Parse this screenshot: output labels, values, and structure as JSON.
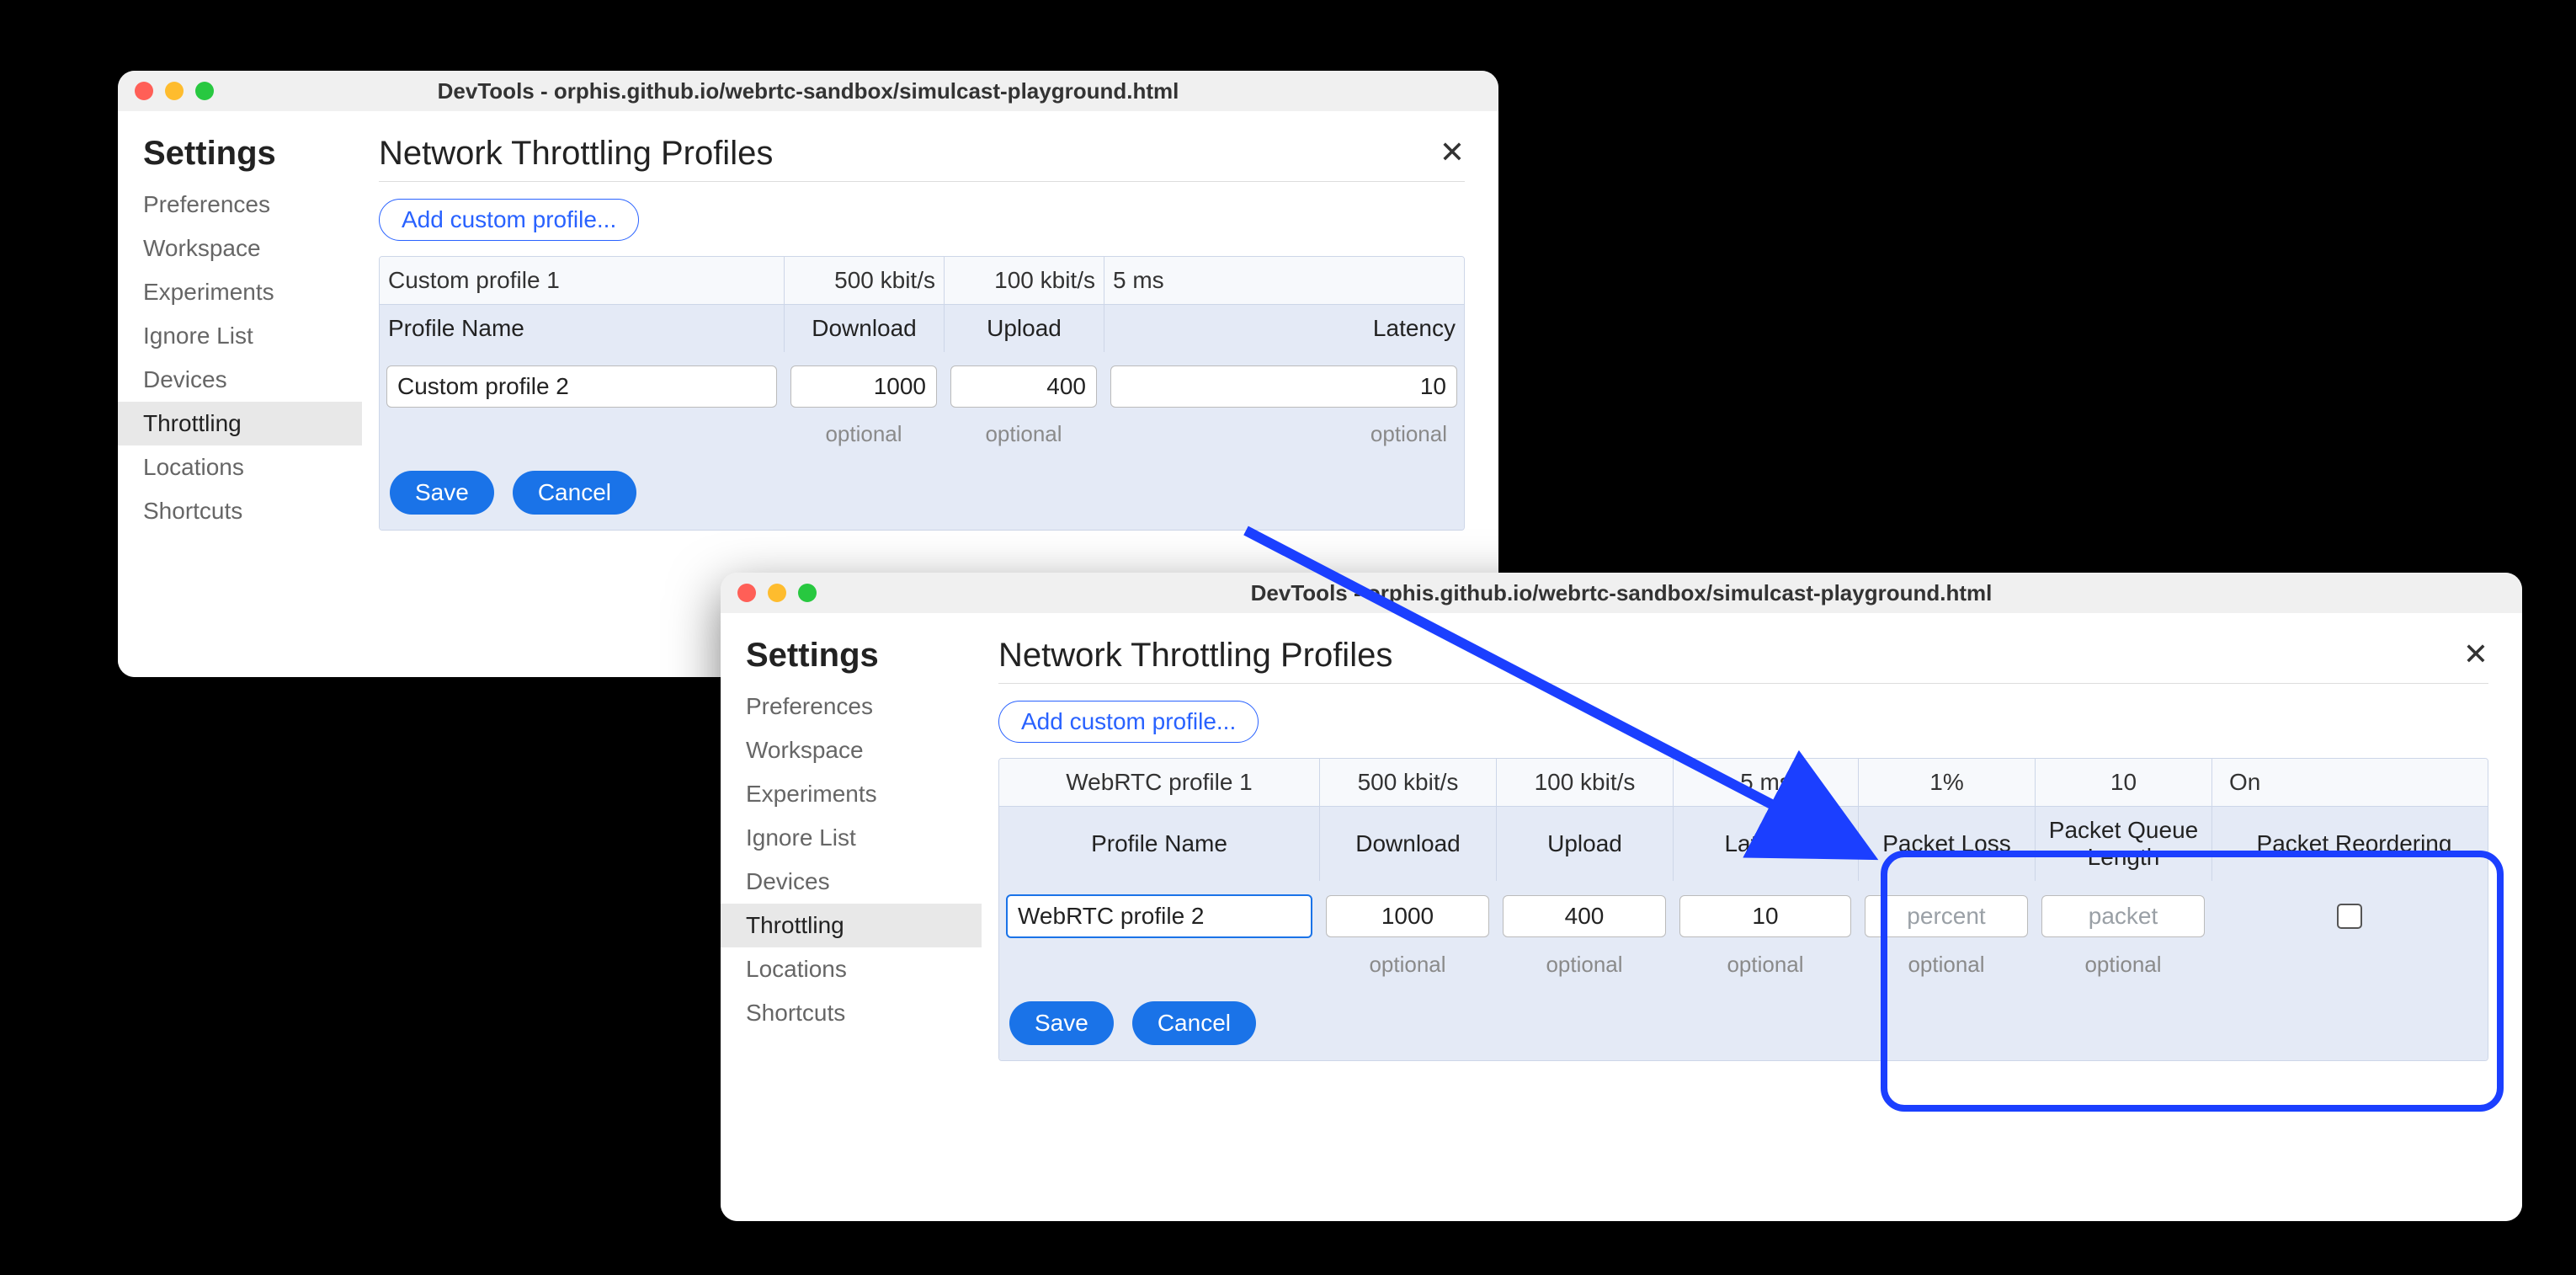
{
  "window_title": "DevTools - orphis.github.io/webrtc-sandbox/simulcast-playground.html",
  "settings_label": "Settings",
  "sidebar": {
    "items": [
      {
        "label": "Preferences"
      },
      {
        "label": "Workspace"
      },
      {
        "label": "Experiments"
      },
      {
        "label": "Ignore List"
      },
      {
        "label": "Devices"
      },
      {
        "label": "Throttling"
      },
      {
        "label": "Locations"
      },
      {
        "label": "Shortcuts"
      }
    ],
    "active_index": 5
  },
  "main": {
    "title": "Network Throttling Profiles",
    "add_button": "Add custom profile...",
    "save": "Save",
    "cancel": "Cancel",
    "optional": "optional"
  },
  "win1": {
    "columns": {
      "name": "Profile Name",
      "download": "Download",
      "upload": "Upload",
      "latency": "Latency"
    },
    "existing": {
      "name": "Custom profile 1",
      "download": "500 kbit/s",
      "upload": "100 kbit/s",
      "latency": "5 ms"
    },
    "editing": {
      "name": "Custom profile 2",
      "download": "1000",
      "upload": "400",
      "latency": "10"
    }
  },
  "win2": {
    "columns": {
      "name": "Profile Name",
      "download": "Download",
      "upload": "Upload",
      "latency": "Latency",
      "packet_loss": "Packet Loss",
      "packet_queue": "Packet Queue Length",
      "packet_reorder": "Packet Reordering"
    },
    "existing": {
      "name": "WebRTC profile 1",
      "download": "500 kbit/s",
      "upload": "100 kbit/s",
      "latency": "5 ms",
      "packet_loss": "1%",
      "packet_queue": "10",
      "packet_reorder": "On"
    },
    "editing": {
      "name": "WebRTC profile 2",
      "download": "1000",
      "upload": "400",
      "latency": "10",
      "packet_loss": "",
      "packet_queue": "",
      "packet_reorder": false
    },
    "placeholders": {
      "packet_loss": "percent",
      "packet_queue": "packet"
    }
  }
}
